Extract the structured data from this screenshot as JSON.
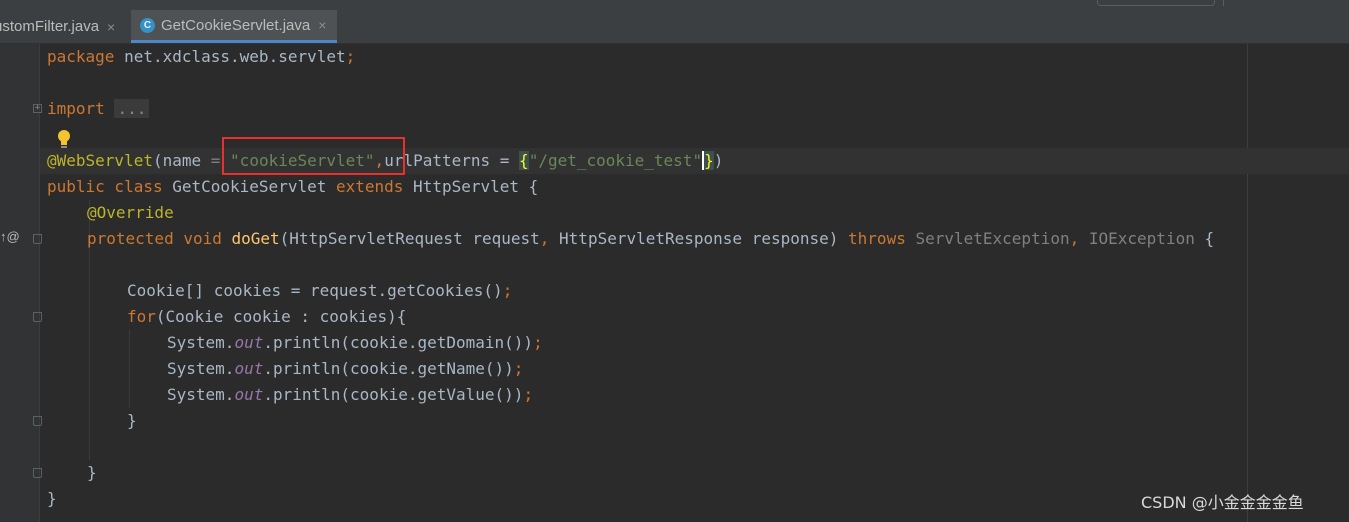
{
  "tabs": [
    {
      "label": "ustomFilter.java",
      "close": "×",
      "active": false
    },
    {
      "label": "GetCookieServlet.java",
      "close": "×",
      "icon": "C",
      "active": true
    }
  ],
  "code": {
    "l1": {
      "kw": "package",
      "rest": " net.xdclass.web.servlet",
      "semi": ";"
    },
    "l3": {
      "kw": "import",
      "sp": " ",
      "fold": "..."
    },
    "l5": {
      "ann": "@WebServlet",
      "a": "(name ",
      "eq": "=",
      "sp": " ",
      "str1": "\"cookieServlet\"",
      "comma": ",",
      "b": "urlPatterns = ",
      "br1": "{",
      "str2": "\"/get_cookie_test\"",
      "br2": "}",
      "c": ")"
    },
    "l6": {
      "kw1": "public class",
      "a": " GetCookieServlet ",
      "kw2": "extends",
      "b": " HttpServlet {"
    },
    "l7": {
      "ann": "@Override"
    },
    "l8": {
      "kw1": "protected void",
      "sp": " ",
      "fn": "doGet",
      "a": "(HttpServletRequest request",
      "c1": ",",
      "b": " HttpServletResponse response) ",
      "kw2": "throws",
      "sp2": " ",
      "ex1": "ServletException",
      "c2": ",",
      "sp3": " ",
      "ex2": "IOException",
      "d": " {"
    },
    "l10": {
      "a": "Cookie[] cookies = request.getCookies()",
      "semi": ";"
    },
    "l11": {
      "kw": "for",
      "a": "(Cookie cookie : cookies){"
    },
    "l12": {
      "a": "System.",
      "st": "out",
      "b": ".println(cookie.getDomain())",
      "semi": ";"
    },
    "l13": {
      "a": "System.",
      "st": "out",
      "b": ".println(cookie.getName())",
      "semi": ";"
    },
    "l14": {
      "a": "System.",
      "st": "out",
      "b": ".println(cookie.getValue())",
      "semi": ";"
    },
    "l15": "}",
    "l17": "}",
    "l18": "}"
  },
  "gutter": {
    "override_marker": "↑@"
  },
  "watermark": "CSDN @小金金金金鱼",
  "colors": {
    "keyword": "#cc7832",
    "annotation": "#bbb529",
    "string": "#6a8759",
    "method": "#ffc66d",
    "static_field": "#9876aa",
    "highlight_box": "#e8312f"
  }
}
